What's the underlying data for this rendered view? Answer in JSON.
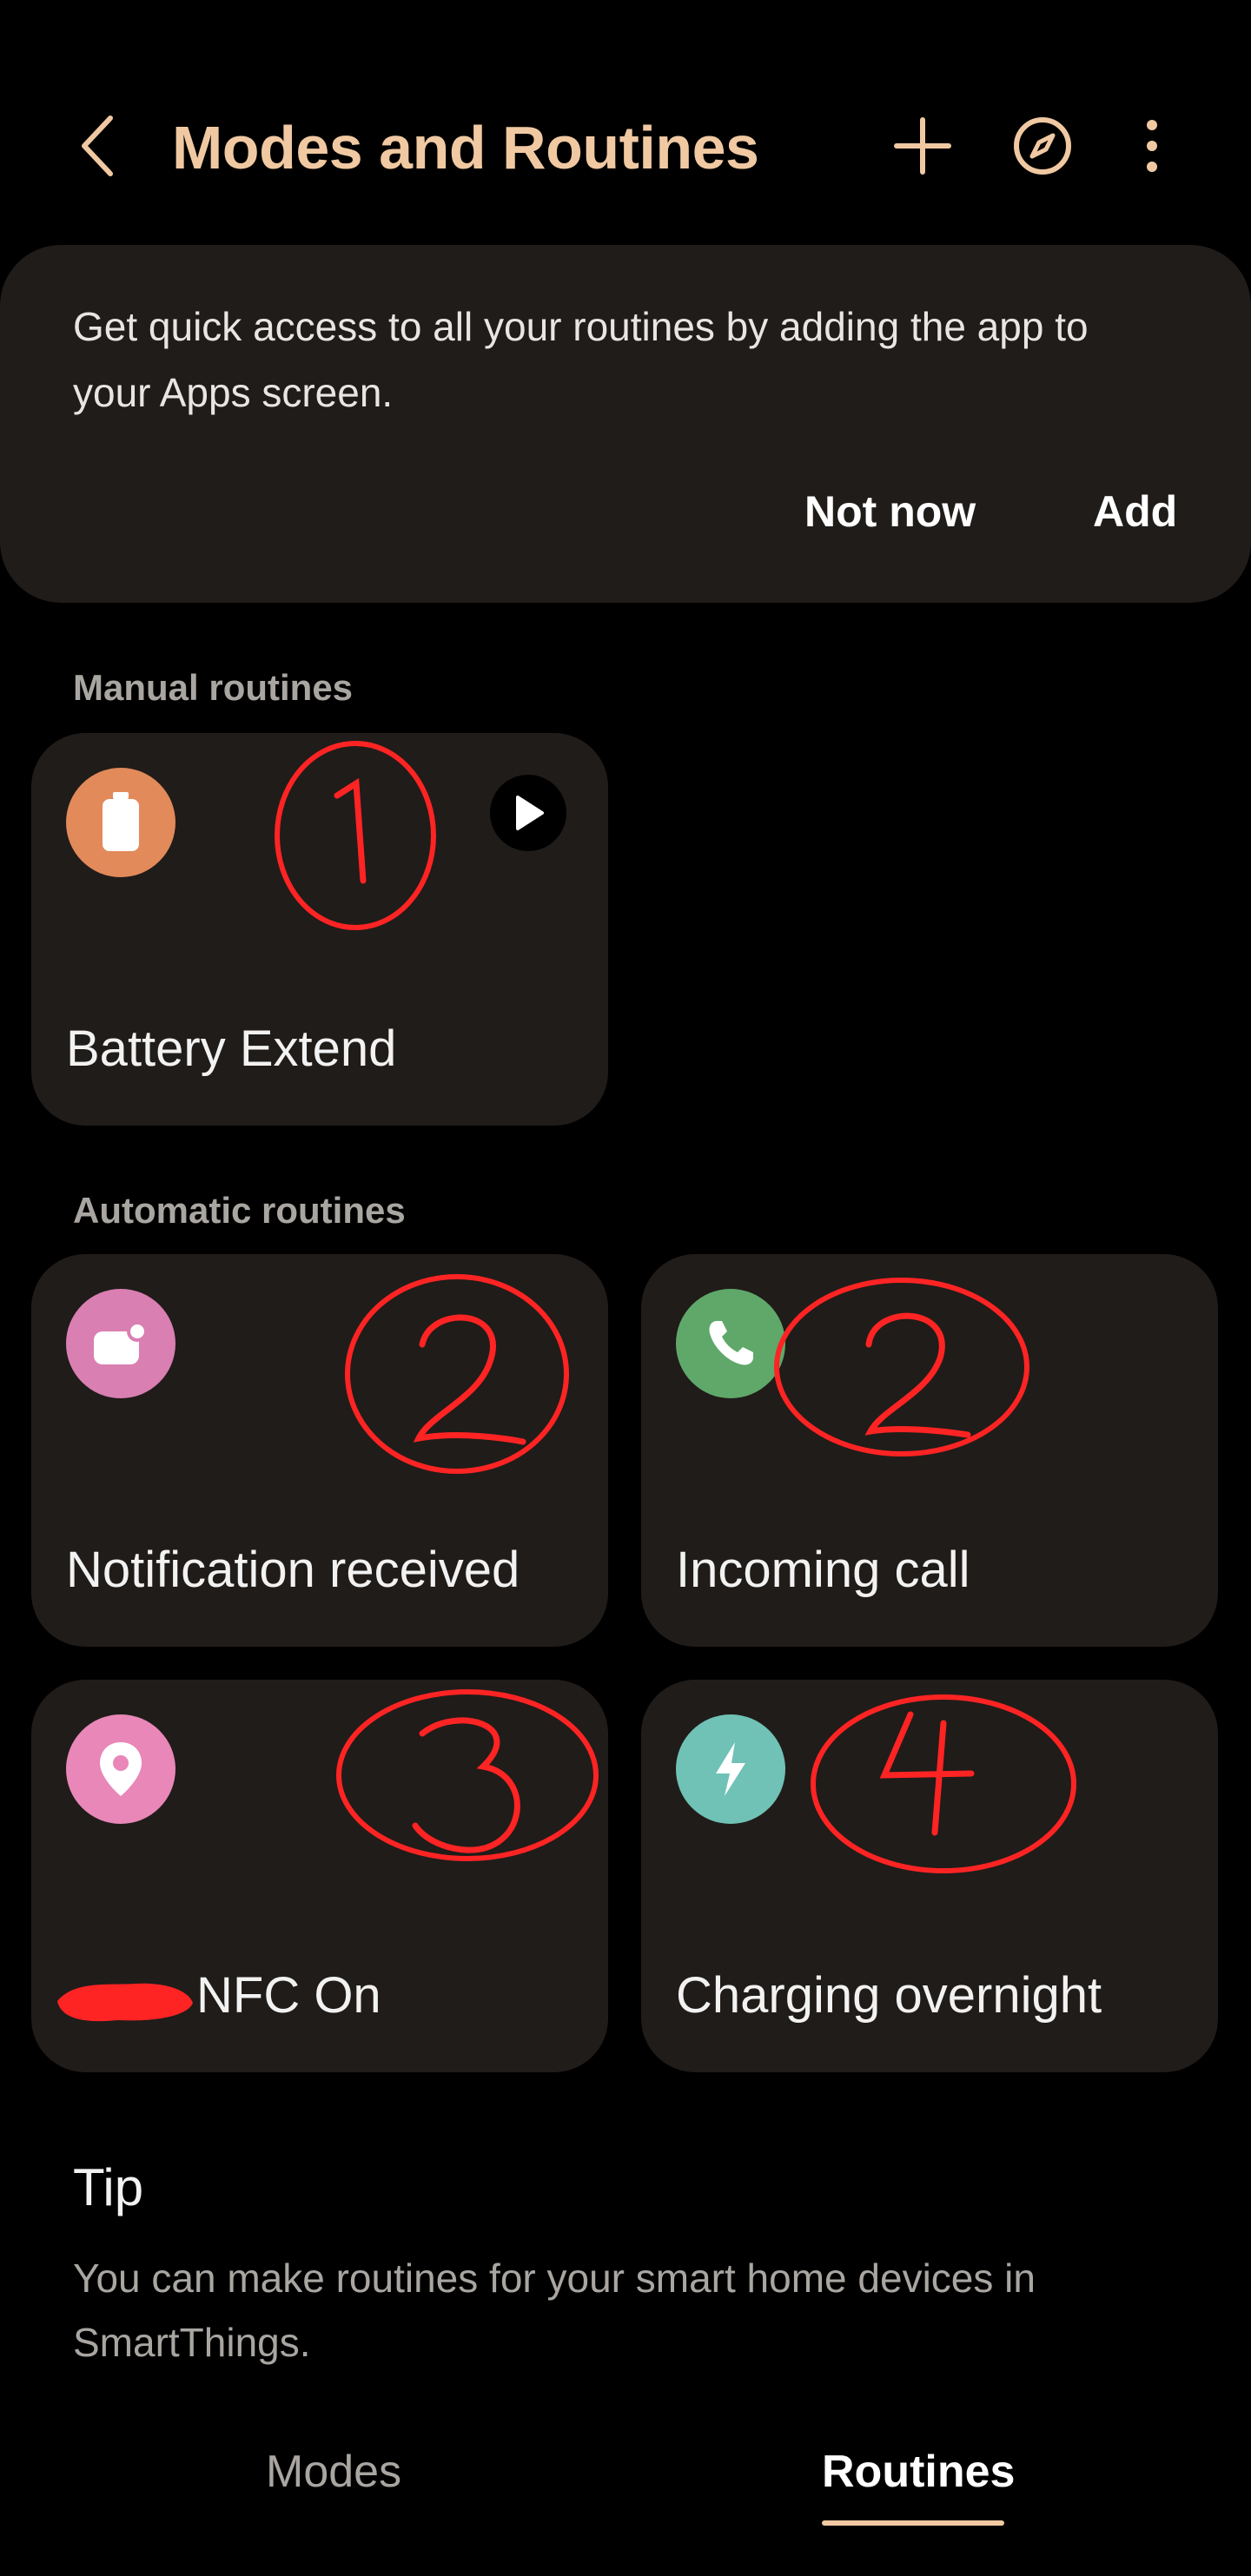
{
  "header": {
    "title": "Modes and Routines",
    "back_icon": "chevron-left-icon",
    "add_icon": "plus-icon",
    "discover_icon": "compass-icon",
    "more_icon": "more-vertical-icon"
  },
  "promo": {
    "text": "Get quick access to all your routines by adding the app to your Apps screen.",
    "not_now_label": "Not now",
    "add_label": "Add"
  },
  "manual_section": {
    "label": "Manual routines",
    "routines": [
      {
        "label": "Battery Extend",
        "icon": "battery-icon",
        "icon_color": "#e28a5a",
        "annotation": "1"
      }
    ]
  },
  "automatic_section": {
    "label": "Automatic routines",
    "routines": [
      {
        "label": "Notification received",
        "icon": "notification-icon",
        "icon_color": "#d97fb2",
        "annotation": "2"
      },
      {
        "label": "Incoming call",
        "icon": "phone-icon",
        "icon_color": "#5fa86a",
        "annotation": "2"
      },
      {
        "label": "NFC On",
        "icon": "location-pin-icon",
        "icon_color": "#e887b8",
        "annotation": "3"
      },
      {
        "label": "Charging overnight",
        "icon": "lightning-icon",
        "icon_color": "#6fc2b5",
        "annotation": "4"
      }
    ]
  },
  "tip": {
    "title": "Tip",
    "text": "You can make routines for your smart home devices in SmartThings."
  },
  "tabs": [
    {
      "label": "Modes",
      "selected": false
    },
    {
      "label": "Routines",
      "selected": true
    }
  ],
  "colors": {
    "accent": "#f0c9a2",
    "card_bg": "#201c19",
    "background": "#000000",
    "annotation": "#ff2424"
  }
}
